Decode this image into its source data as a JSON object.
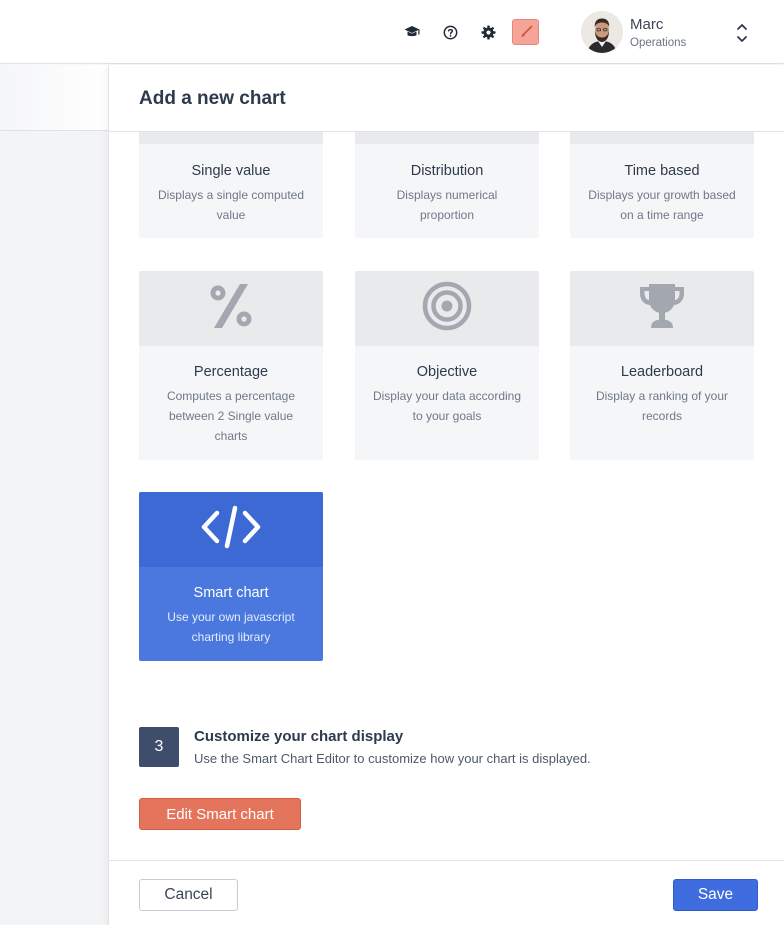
{
  "topbar": {
    "icons": [
      "graduation-cap-icon",
      "help-circle-icon",
      "gear-icon",
      "paint-brush-icon"
    ],
    "user": {
      "name": "Marc",
      "role": "Operations"
    },
    "brand_color": "#f4a597"
  },
  "panel": {
    "title": "Add a new chart",
    "cards": [
      {
        "title": "Single value",
        "desc": "Displays a single computed value",
        "selected": false
      },
      {
        "title": "Distribution",
        "desc": "Displays numerical proportion",
        "selected": false
      },
      {
        "title": "Time based",
        "desc": "Displays your growth based on a time range",
        "selected": false
      },
      {
        "title": "Percentage",
        "desc": "Computes a percentage between 2 Single value charts",
        "icon": "percent-icon",
        "selected": false
      },
      {
        "title": "Objective",
        "desc": "Display your data according to your goals",
        "icon": "target-icon",
        "selected": false
      },
      {
        "title": "Leaderboard",
        "desc": "Display a ranking of your records",
        "icon": "trophy-icon",
        "selected": false
      },
      {
        "title": "Smart chart",
        "desc": "Use your own javascript charting library",
        "icon": "code-icon",
        "selected": true
      }
    ],
    "step": {
      "number": "3",
      "title": "Customize your chart display",
      "desc": "Use the Smart Chart Editor to customize how your chart is displayed."
    },
    "edit_button": "Edit Smart chart",
    "footer": {
      "cancel": "Cancel",
      "save": "Save"
    },
    "colors": {
      "accent": "#3f6de0",
      "selected_card": "#4a78de",
      "edit_button": "#e4755c",
      "step_badge": "#3e4d69"
    }
  }
}
